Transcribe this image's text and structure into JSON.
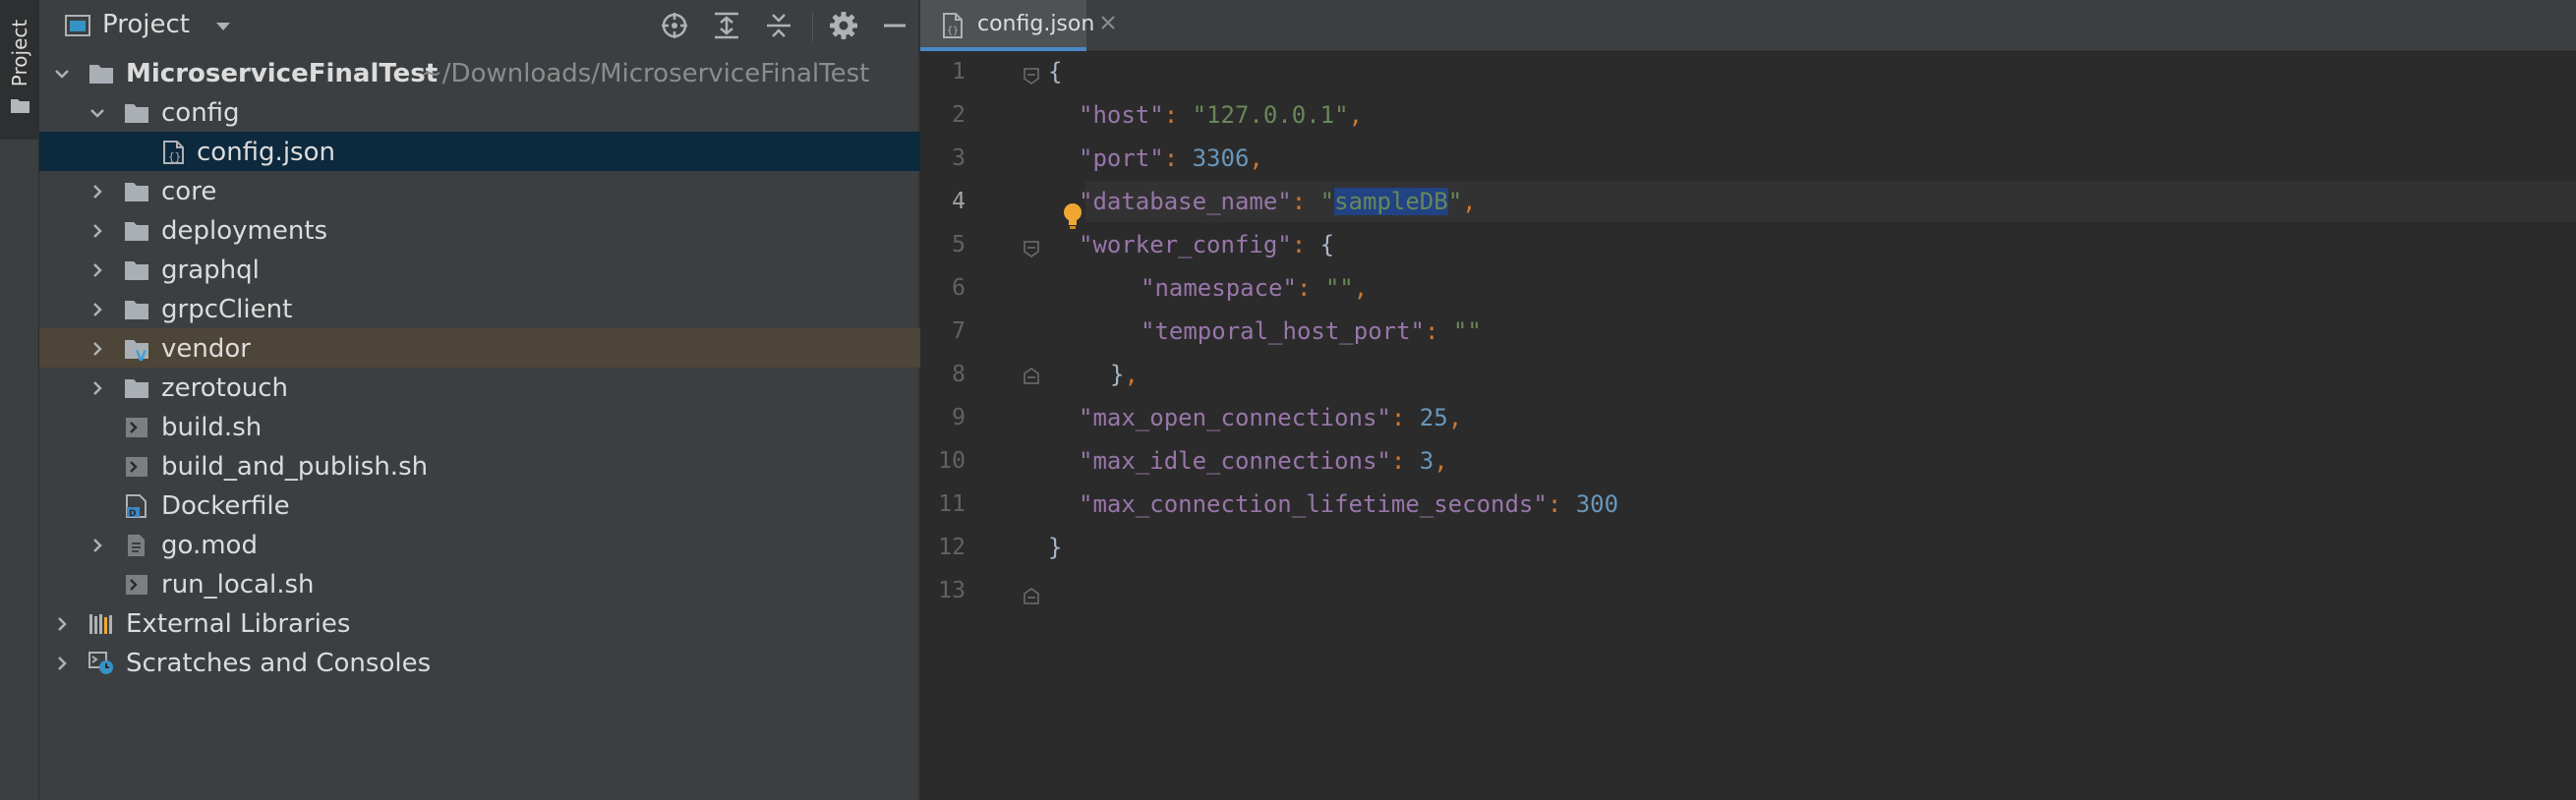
{
  "toolstrip": {
    "project_tab_label": "Project"
  },
  "project_panel": {
    "title": "Project",
    "tree": [
      {
        "label": "MicroserviceFinalTest",
        "path": "~/Downloads/MicroserviceFinalTest",
        "icon": "folder-icon",
        "expanded": true
      },
      {
        "label": "config",
        "icon": "folder-icon",
        "expanded": true
      },
      {
        "label": "config.json",
        "icon": "json-file-icon",
        "selected": true
      },
      {
        "label": "core",
        "icon": "folder-icon"
      },
      {
        "label": "deployments",
        "icon": "folder-icon"
      },
      {
        "label": "graphql",
        "icon": "folder-icon"
      },
      {
        "label": "grpcClient",
        "icon": "folder-icon"
      },
      {
        "label": "vendor",
        "icon": "vendor-folder-icon",
        "excluded": true
      },
      {
        "label": "zerotouch",
        "icon": "folder-icon"
      },
      {
        "label": "build.sh",
        "icon": "shell-script-icon"
      },
      {
        "label": "build_and_publish.sh",
        "icon": "shell-script-icon"
      },
      {
        "label": "Dockerfile",
        "icon": "dockerfile-icon"
      },
      {
        "label": "go.mod",
        "icon": "go-mod-icon"
      },
      {
        "label": "run_local.sh",
        "icon": "shell-script-icon"
      },
      {
        "label": "External Libraries",
        "icon": "libraries-icon"
      },
      {
        "label": "Scratches and Consoles",
        "icon": "scratches-icon"
      }
    ]
  },
  "editor": {
    "tabs": [
      {
        "label": "config.json",
        "active": true
      }
    ],
    "line_numbers": [
      "1",
      "2",
      "3",
      "4",
      "5",
      "6",
      "7",
      "8",
      "9",
      "10",
      "11",
      "12",
      "13"
    ],
    "current_line": 4,
    "code": {
      "brace_open": "{",
      "brace_close": "}",
      "l2_key": "\"host\"",
      "l2_val": "\"127.0.0.1\"",
      "l3_key_q": "\"",
      "l3_key_rest": "port\"",
      "l3_val": "3306",
      "l4_key": "\"database_name\"",
      "l4_q1": "\"",
      "l4_sel": "sampleDB",
      "l4_q2": "\"",
      "l5_key": "\"worker_config\"",
      "l6_key": "\"namespace\"",
      "l6_val": "\"\"",
      "l7_key": "\"temporal_host_port\"",
      "l7_val": "\"\"",
      "l8_close": "}",
      "l9_key": "\"max_open_connections\"",
      "l9_val": "25",
      "l10_key": "\"max_idle_connections\"",
      "l10_val": "3",
      "l11_key": "\"max_connection_lifetime_seconds\"",
      "l11_val": "300",
      "colon": ": ",
      "comma": ","
    }
  },
  "colors": {
    "panel_bg": "#3c3f41",
    "editor_bg": "#2b2b2b",
    "selection": "#0d293e",
    "excluded": "#4d4537",
    "key": "#9876aa",
    "string": "#6a8759",
    "number": "#6897bb",
    "punctuation": "#cc7832"
  }
}
